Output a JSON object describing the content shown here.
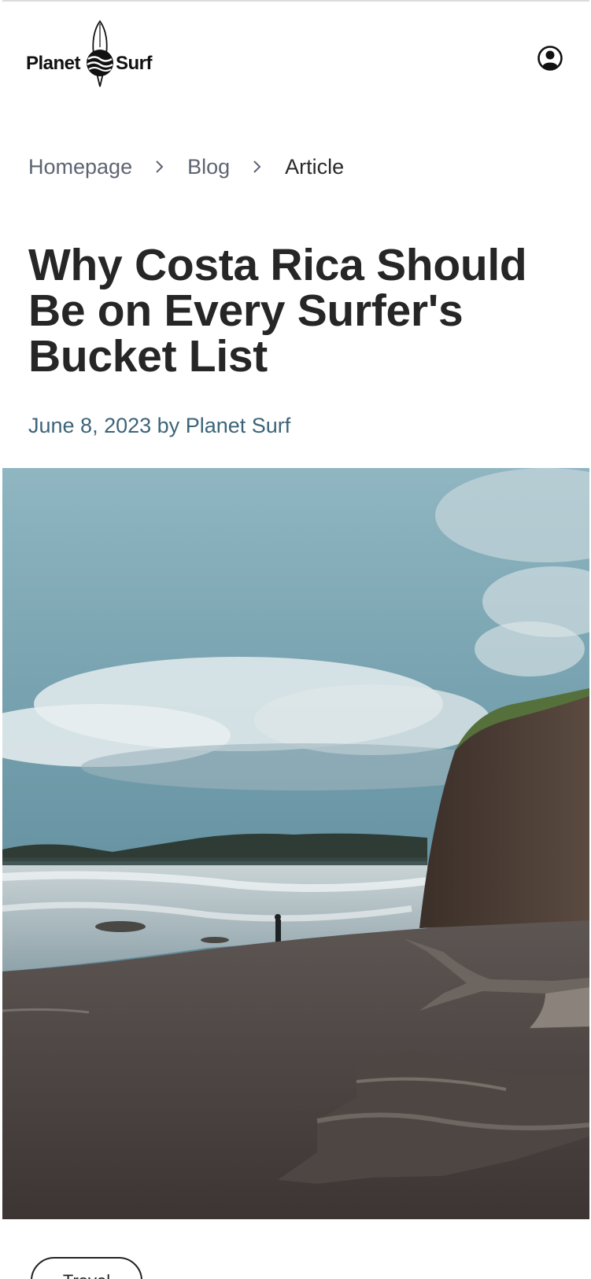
{
  "header": {
    "logo_left": "Planet",
    "logo_right": "Surf",
    "account_icon": "user-circle-icon"
  },
  "breadcrumb": {
    "items": [
      "Homepage",
      "Blog",
      "Article"
    ],
    "separator_icon": "chevron-right-icon"
  },
  "article": {
    "title": "Why Costa Rica Should Be on Every Surfer's Bucket List",
    "date": "June 8, 2023",
    "by": "by",
    "author": "Planet Surf",
    "hero_image": "beach-photo"
  },
  "tags": {
    "first_label": "Travel"
  },
  "colors": {
    "text": "#262626",
    "muted": "#5f6472",
    "meta": "#3c6478"
  }
}
